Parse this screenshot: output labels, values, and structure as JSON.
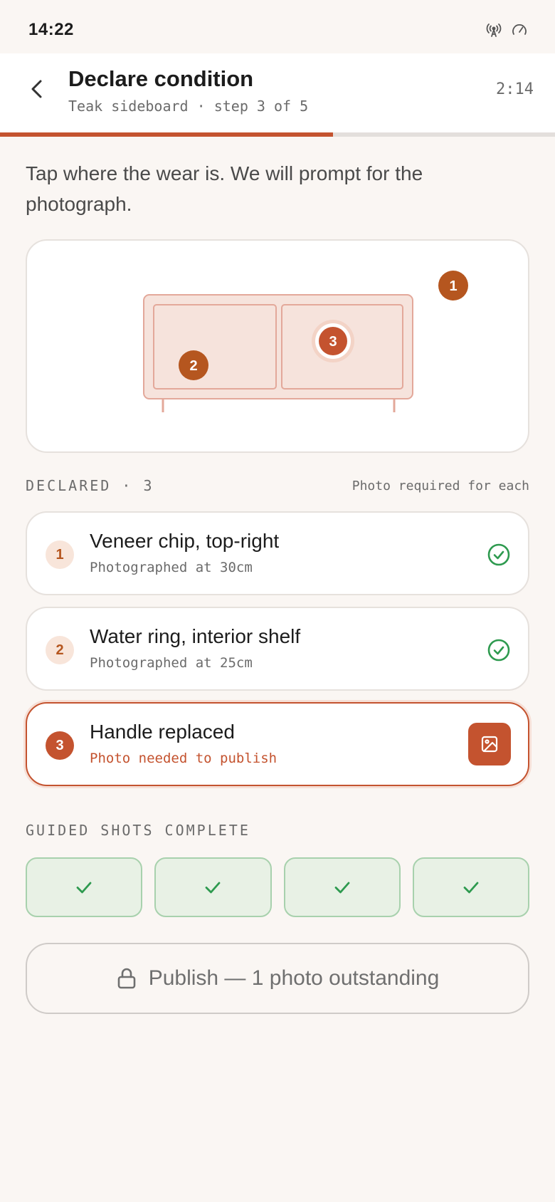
{
  "status_bar": {
    "time": "14:22",
    "icons": [
      "antenna-icon",
      "speedometer-icon"
    ]
  },
  "header": {
    "title": "Declare condition",
    "subtitle": "Teak sideboard · step 3 of 5",
    "timer": "2:14",
    "progress_fraction": 0.6
  },
  "intro": "Tap where the wear is. We will prompt for the photograph.",
  "diagram": {
    "markers": [
      {
        "number": "1"
      },
      {
        "number": "2"
      },
      {
        "number": "3",
        "active": true
      }
    ]
  },
  "declared": {
    "heading": "DECLARED · 3",
    "note": "Photo required for each",
    "items": [
      {
        "number": "1",
        "label": "Veneer chip, top-right",
        "status": "Photographed at 30cm",
        "done": true
      },
      {
        "number": "2",
        "label": "Water ring, interior shelf",
        "status": "Photographed at 25cm",
        "done": true
      },
      {
        "number": "3",
        "label": "Handle replaced",
        "status": "Photo needed to publish",
        "done": false
      }
    ]
  },
  "guided_shots": {
    "heading": "GUIDED SHOTS COMPLETE",
    "count": 4,
    "completed": 4
  },
  "publish": {
    "label": "Publish — 1 photo outstanding",
    "icon": "lock-icon"
  },
  "colors": {
    "accent": "#c4532f",
    "marker": "#b5561f",
    "success": "#2e9a4f",
    "background": "#faf6f3"
  }
}
